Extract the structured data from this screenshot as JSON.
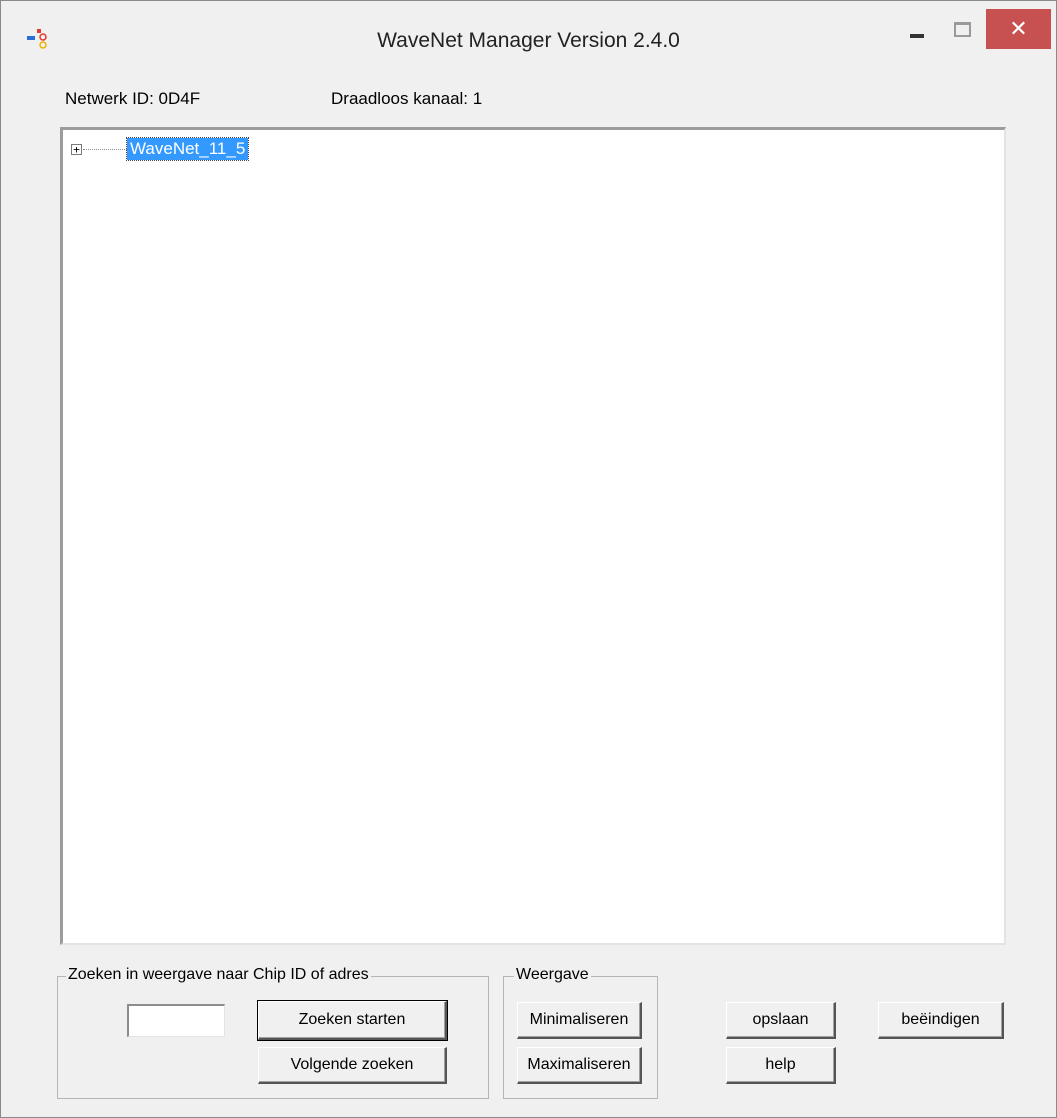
{
  "window": {
    "title": "WaveNet Manager Version 2.4.0",
    "close_glyph": "✕"
  },
  "info": {
    "network_id": "Netwerk ID: 0D4F",
    "wireless_channel": "Draadloos kanaal: 1"
  },
  "tree": {
    "expander_glyph": "+",
    "root_node": "WaveNet_11_5"
  },
  "search_group": {
    "legend": "Zoeken in weergave naar Chip ID of adres",
    "input_value": "",
    "start_button": "Zoeken starten",
    "next_button": "Volgende zoeken"
  },
  "view_group": {
    "legend": "Weergave",
    "minimize_button": "Minimaliseren",
    "maximize_button": "Maximaliseren"
  },
  "actions": {
    "save_button": "opslaan",
    "help_button": "help",
    "exit_button": "beëindigen"
  },
  "colors": {
    "selection": "#3399ff",
    "close_button": "#c75050",
    "window_bg": "#f0f0f0"
  },
  "icons": {
    "app": "app-icon",
    "minimize": "minimize-icon",
    "maximize": "maximize-icon",
    "close": "close-icon"
  }
}
